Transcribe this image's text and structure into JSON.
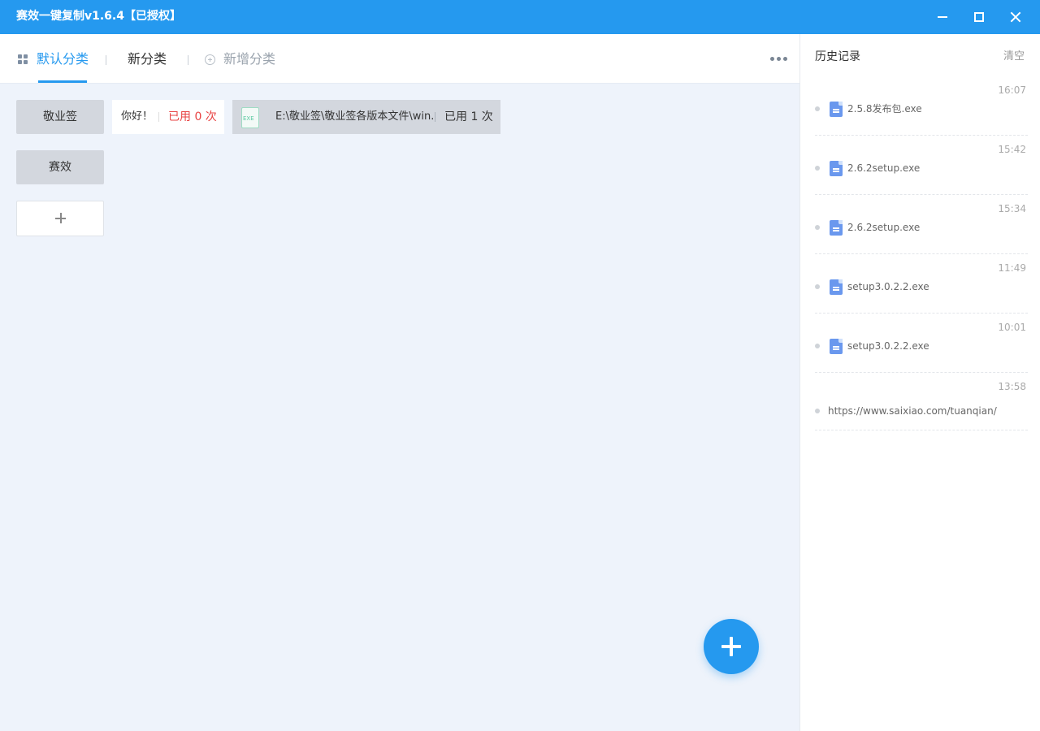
{
  "window": {
    "title": "赛效一键复制v1.6.4【已授权】"
  },
  "tabs": [
    {
      "label": "默认分类",
      "active": true
    },
    {
      "label": "新分类",
      "active": false
    },
    {
      "label": "新增分类",
      "active": false
    }
  ],
  "groups": [
    {
      "label": "敬业签"
    },
    {
      "label": "赛效"
    }
  ],
  "snippets": [
    {
      "text": "你好！",
      "used": "已用 0 次"
    },
    {
      "path": "E:\\敬业签\\敬业签各版本文件\\win...",
      "used": "已用 1 次",
      "icon": "exe-file-icon"
    }
  ],
  "history": {
    "title": "历史记录",
    "clear_label": "清空",
    "items": [
      {
        "time": "16:07",
        "name": "2.5.8发布包.exe",
        "icon": "file-icon"
      },
      {
        "time": "15:42",
        "name": "2.6.2setup.exe",
        "icon": "file-icon"
      },
      {
        "time": "15:34",
        "name": "2.6.2setup.exe",
        "icon": "file-icon"
      },
      {
        "time": "11:49",
        "name": "setup3.0.2.2.exe",
        "icon": "file-icon"
      },
      {
        "time": "10:01",
        "name": "setup3.0.2.2.exe",
        "icon": "file-icon"
      },
      {
        "time": "13:58",
        "name": "https://www.saixiao.com/tuanqian/"
      }
    ]
  },
  "colors": {
    "accent": "#2599ef",
    "used_count_red": "#e84343",
    "main_background": "#eef3fb"
  }
}
